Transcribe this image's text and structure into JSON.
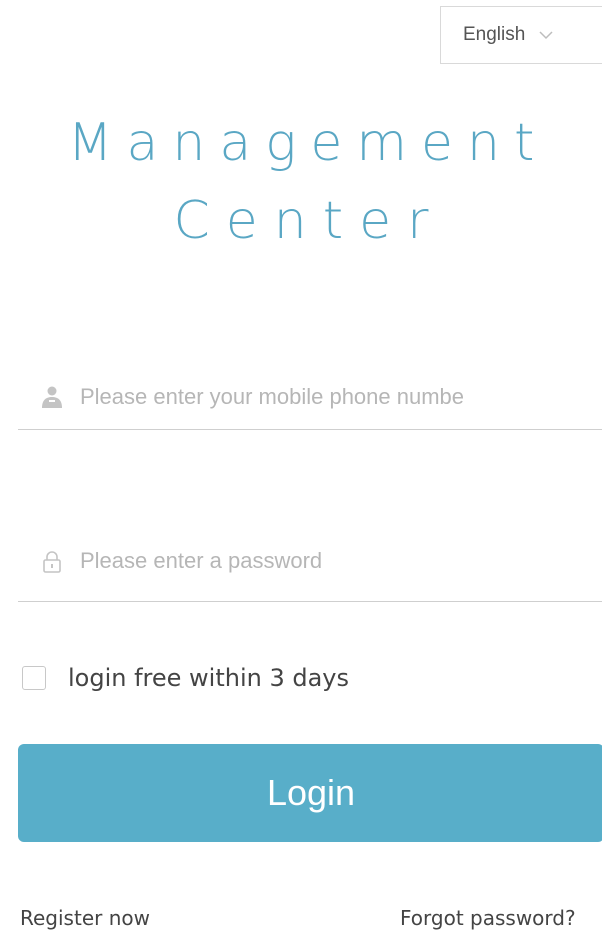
{
  "language_selector": {
    "selected": "English"
  },
  "title": {
    "line1": "Management",
    "line2": "Center"
  },
  "form": {
    "phone": {
      "placeholder": "Please enter your mobile phone numbe",
      "value": ""
    },
    "password": {
      "placeholder": "Please enter a password",
      "value": ""
    },
    "remember": {
      "label": "login free within 3 days",
      "checked": false
    },
    "login_button": "Login"
  },
  "footer": {
    "register": "Register now",
    "forgot": "Forgot password?"
  },
  "colors": {
    "accent": "#58aec9",
    "title": "#5aa7c4",
    "placeholder": "#b6b6b6"
  },
  "icons": {
    "phone_field": "user-icon",
    "password_field": "lock-icon",
    "dropdown": "chevron-down-icon"
  }
}
